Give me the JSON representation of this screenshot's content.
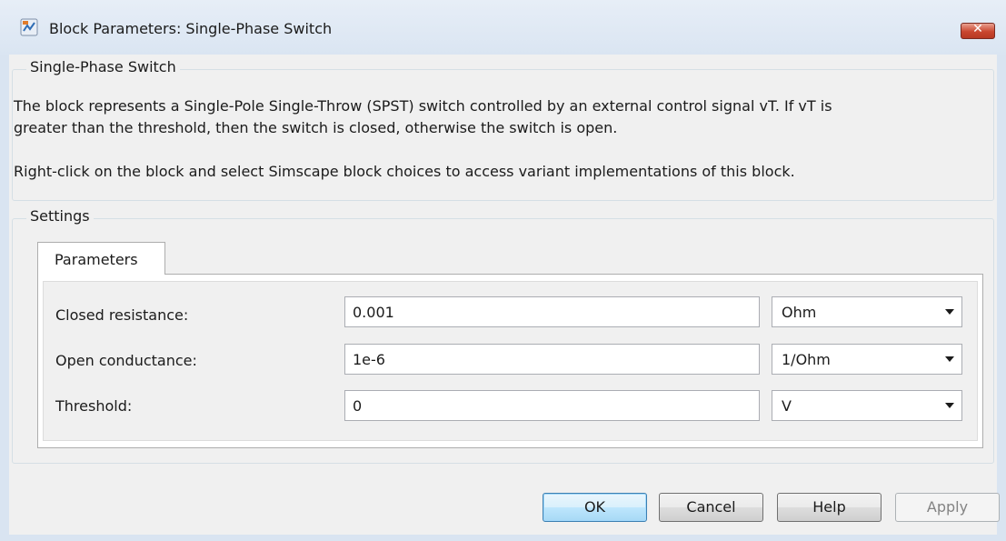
{
  "window": {
    "title": "Block Parameters: Single-Phase Switch",
    "close_label": "✕"
  },
  "description_group": {
    "legend": "Single-Phase Switch",
    "lines": [
      "The block represents a Single-Pole Single-Throw (SPST) switch controlled by an external control signal vT. If vT is",
      "greater than the threshold, then the switch is closed, otherwise the switch is open.",
      "Right-click on the block and select Simscape block choices to access variant implementations of this block."
    ]
  },
  "settings": {
    "legend": "Settings",
    "tab_label": "Parameters",
    "params": [
      {
        "label": "Closed resistance:",
        "value": "0.001",
        "unit": "Ohm"
      },
      {
        "label": "Open conductance:",
        "value": "1e-6",
        "unit": "1/Ohm"
      },
      {
        "label": "Threshold:",
        "value": "0",
        "unit": "V"
      }
    ]
  },
  "buttons": {
    "ok": "OK",
    "cancel": "Cancel",
    "help": "Help",
    "apply": "Apply"
  },
  "colors": {
    "title_bar": "#dae5f2",
    "client_bg": "#f0f0f0",
    "close_button": "#c9462f",
    "ok_button": "#bee6fd"
  },
  "icons": {
    "app": "simulink-block-icon",
    "close": "close-icon",
    "dropdown": "chevron-down-icon"
  }
}
